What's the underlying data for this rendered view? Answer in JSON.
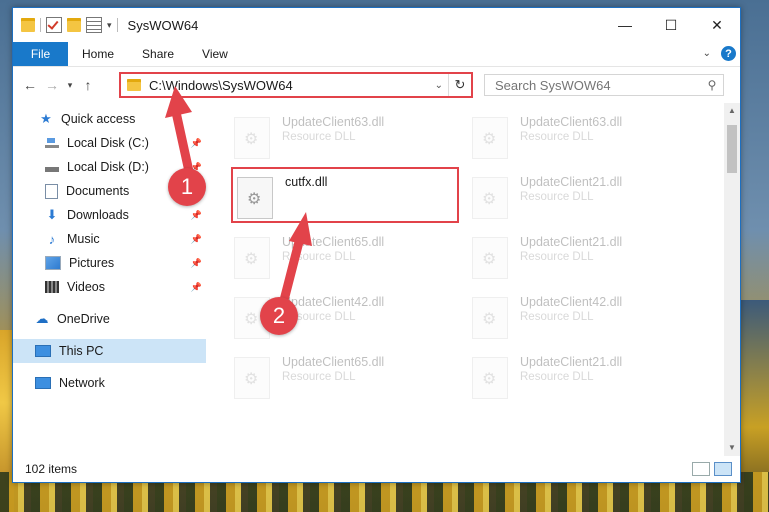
{
  "window": {
    "title": "SysWOW64"
  },
  "window_controls": {
    "minimize": "—",
    "maximize": "☐",
    "close": "✕"
  },
  "ribbon": {
    "tabs": [
      "File",
      "Home",
      "Share",
      "View"
    ]
  },
  "address": {
    "path": "C:\\Windows\\SysWOW64"
  },
  "search": {
    "placeholder": "Search SysWOW64"
  },
  "nav": {
    "items": [
      {
        "label": "Quick access",
        "icon": "star-icon"
      },
      {
        "label": "Local Disk (C:)",
        "icon": "disk-icon",
        "pinned": true
      },
      {
        "label": "Local Disk (D:)",
        "icon": "disk-icon",
        "pinned": true
      },
      {
        "label": "Documents",
        "icon": "documents-icon",
        "pinned": true
      },
      {
        "label": "Downloads",
        "icon": "download-icon",
        "pinned": true
      },
      {
        "label": "Music",
        "icon": "music-icon",
        "pinned": true
      },
      {
        "label": "Pictures",
        "icon": "pictures-icon",
        "pinned": true
      },
      {
        "label": "Videos",
        "icon": "videos-icon",
        "pinned": true
      },
      {
        "label": "OneDrive",
        "icon": "cloud-icon"
      },
      {
        "label": "This PC",
        "icon": "pc-icon",
        "selected": true
      },
      {
        "label": "Network",
        "icon": "network-icon"
      }
    ]
  },
  "files": [
    {
      "name": "UpdateClient63.dll",
      "type": "Resource DLL"
    },
    {
      "name": "UpdateClient63.dll",
      "type": "Resource DLL"
    },
    {
      "name": "cutfx.dll",
      "type": ""
    },
    {
      "name": "UpdateClient21.dll",
      "type": "Resource DLL"
    },
    {
      "name": "UpdateClient65.dll",
      "type": "Resource DLL"
    },
    {
      "name": "UpdateClient21.dll",
      "type": "Resource DLL"
    },
    {
      "name": "UpdateClient42.dll",
      "type": "Resource DLL"
    },
    {
      "name": "UpdateClient42.dll",
      "type": "Resource DLL"
    },
    {
      "name": "UpdateClient65.dll",
      "type": "Resource DLL"
    },
    {
      "name": "UpdateClient21.dll",
      "type": "Resource DLL"
    }
  ],
  "status": {
    "item_count": "102 items"
  },
  "callouts": [
    "1",
    "2"
  ],
  "colors": {
    "accent": "#1979ca",
    "highlight": "#e2434a",
    "selected_bg": "#cce4f7"
  }
}
